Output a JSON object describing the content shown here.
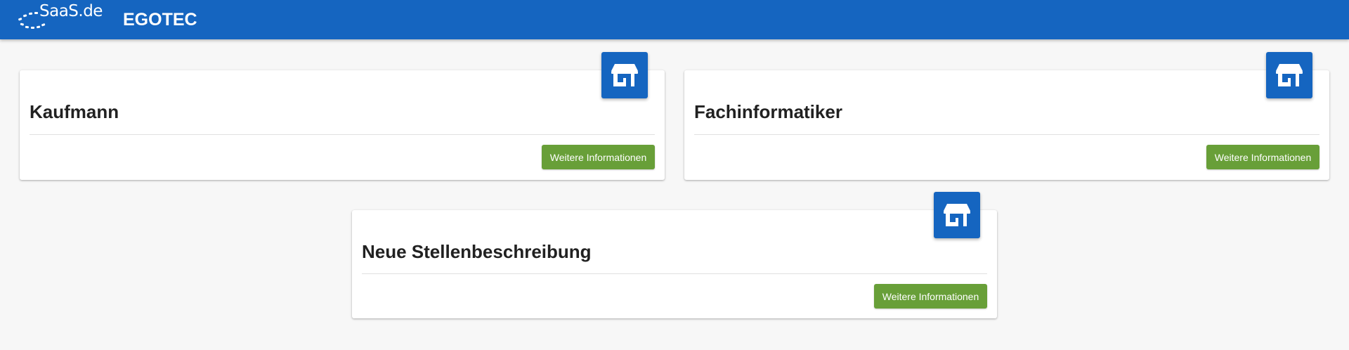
{
  "header": {
    "logo_text": "SaaS.de",
    "brand": "EGOTEC"
  },
  "cards": [
    {
      "title": "Kaufmann",
      "icon": "store-icon",
      "button_label": "Weitere Informationen"
    },
    {
      "title": "Fachinformatiker",
      "icon": "store-icon",
      "button_label": "Weitere Informationen"
    },
    {
      "title": "Neue Stellenbeschreibung",
      "icon": "store-icon",
      "button_label": "Weitere Informationen"
    }
  ],
  "colors": {
    "header": "#1565c0",
    "icon_tile": "#1565c0",
    "button": "#689f38",
    "background": "#f7f7f7"
  }
}
